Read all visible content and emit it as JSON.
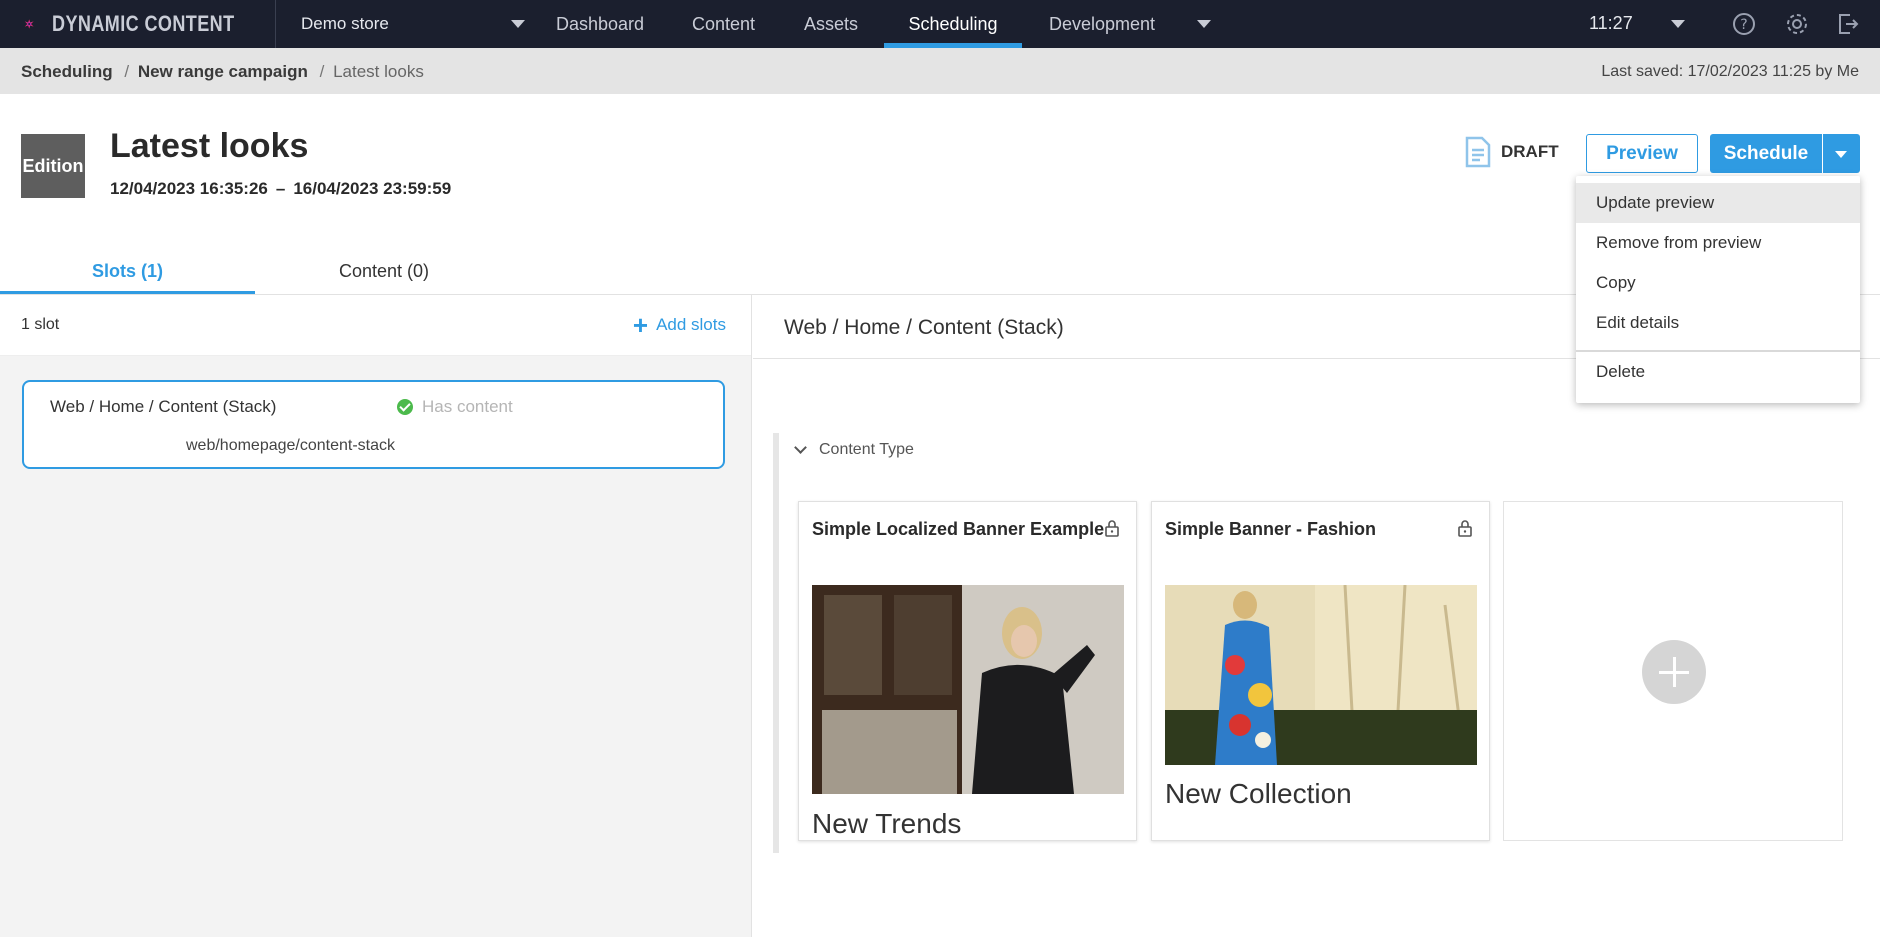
{
  "topnav": {
    "brand": "DYNAMIC CONTENT",
    "store": "Demo store",
    "tabs": [
      {
        "label": "Dashboard"
      },
      {
        "label": "Content"
      },
      {
        "label": "Assets"
      },
      {
        "label": "Scheduling",
        "active": true
      },
      {
        "label": "Development"
      }
    ],
    "time": "11:27",
    "icons": [
      "help-icon",
      "gear-icon",
      "logout-icon"
    ],
    "accent": "#2f9be2",
    "background": "#1b1f2e"
  },
  "breadcrumb": {
    "items": [
      "Scheduling",
      "New range campaign",
      "Latest looks"
    ],
    "last_saved": "Last saved: 17/02/2023 11:25 by Me"
  },
  "header": {
    "badge": "Edition",
    "title": "Latest looks",
    "start": "12/04/2023 16:35:26",
    "dash": "–",
    "end": "16/04/2023 23:59:59",
    "status": "DRAFT",
    "preview_label": "Preview",
    "schedule_label": "Schedule"
  },
  "menu": {
    "items": [
      "Update preview",
      "Remove from preview",
      "Copy",
      "Edit details",
      "Delete"
    ]
  },
  "tabs": {
    "slots": "Slots (1)",
    "content": "Content (0)"
  },
  "left": {
    "count": "1 slot",
    "add_label": "Add slots",
    "slot": {
      "name": "Web / Home / Content (Stack)",
      "status": "Has content",
      "path": "web/homepage/content-stack"
    }
  },
  "right": {
    "title": "Web / Home / Content (Stack)",
    "content_type_label": "Content Type",
    "cards": [
      {
        "title": "Simple Localized Banner Example",
        "caption": "New Trends"
      },
      {
        "title": "Simple Banner - Fashion",
        "caption": "New Collection"
      }
    ]
  }
}
